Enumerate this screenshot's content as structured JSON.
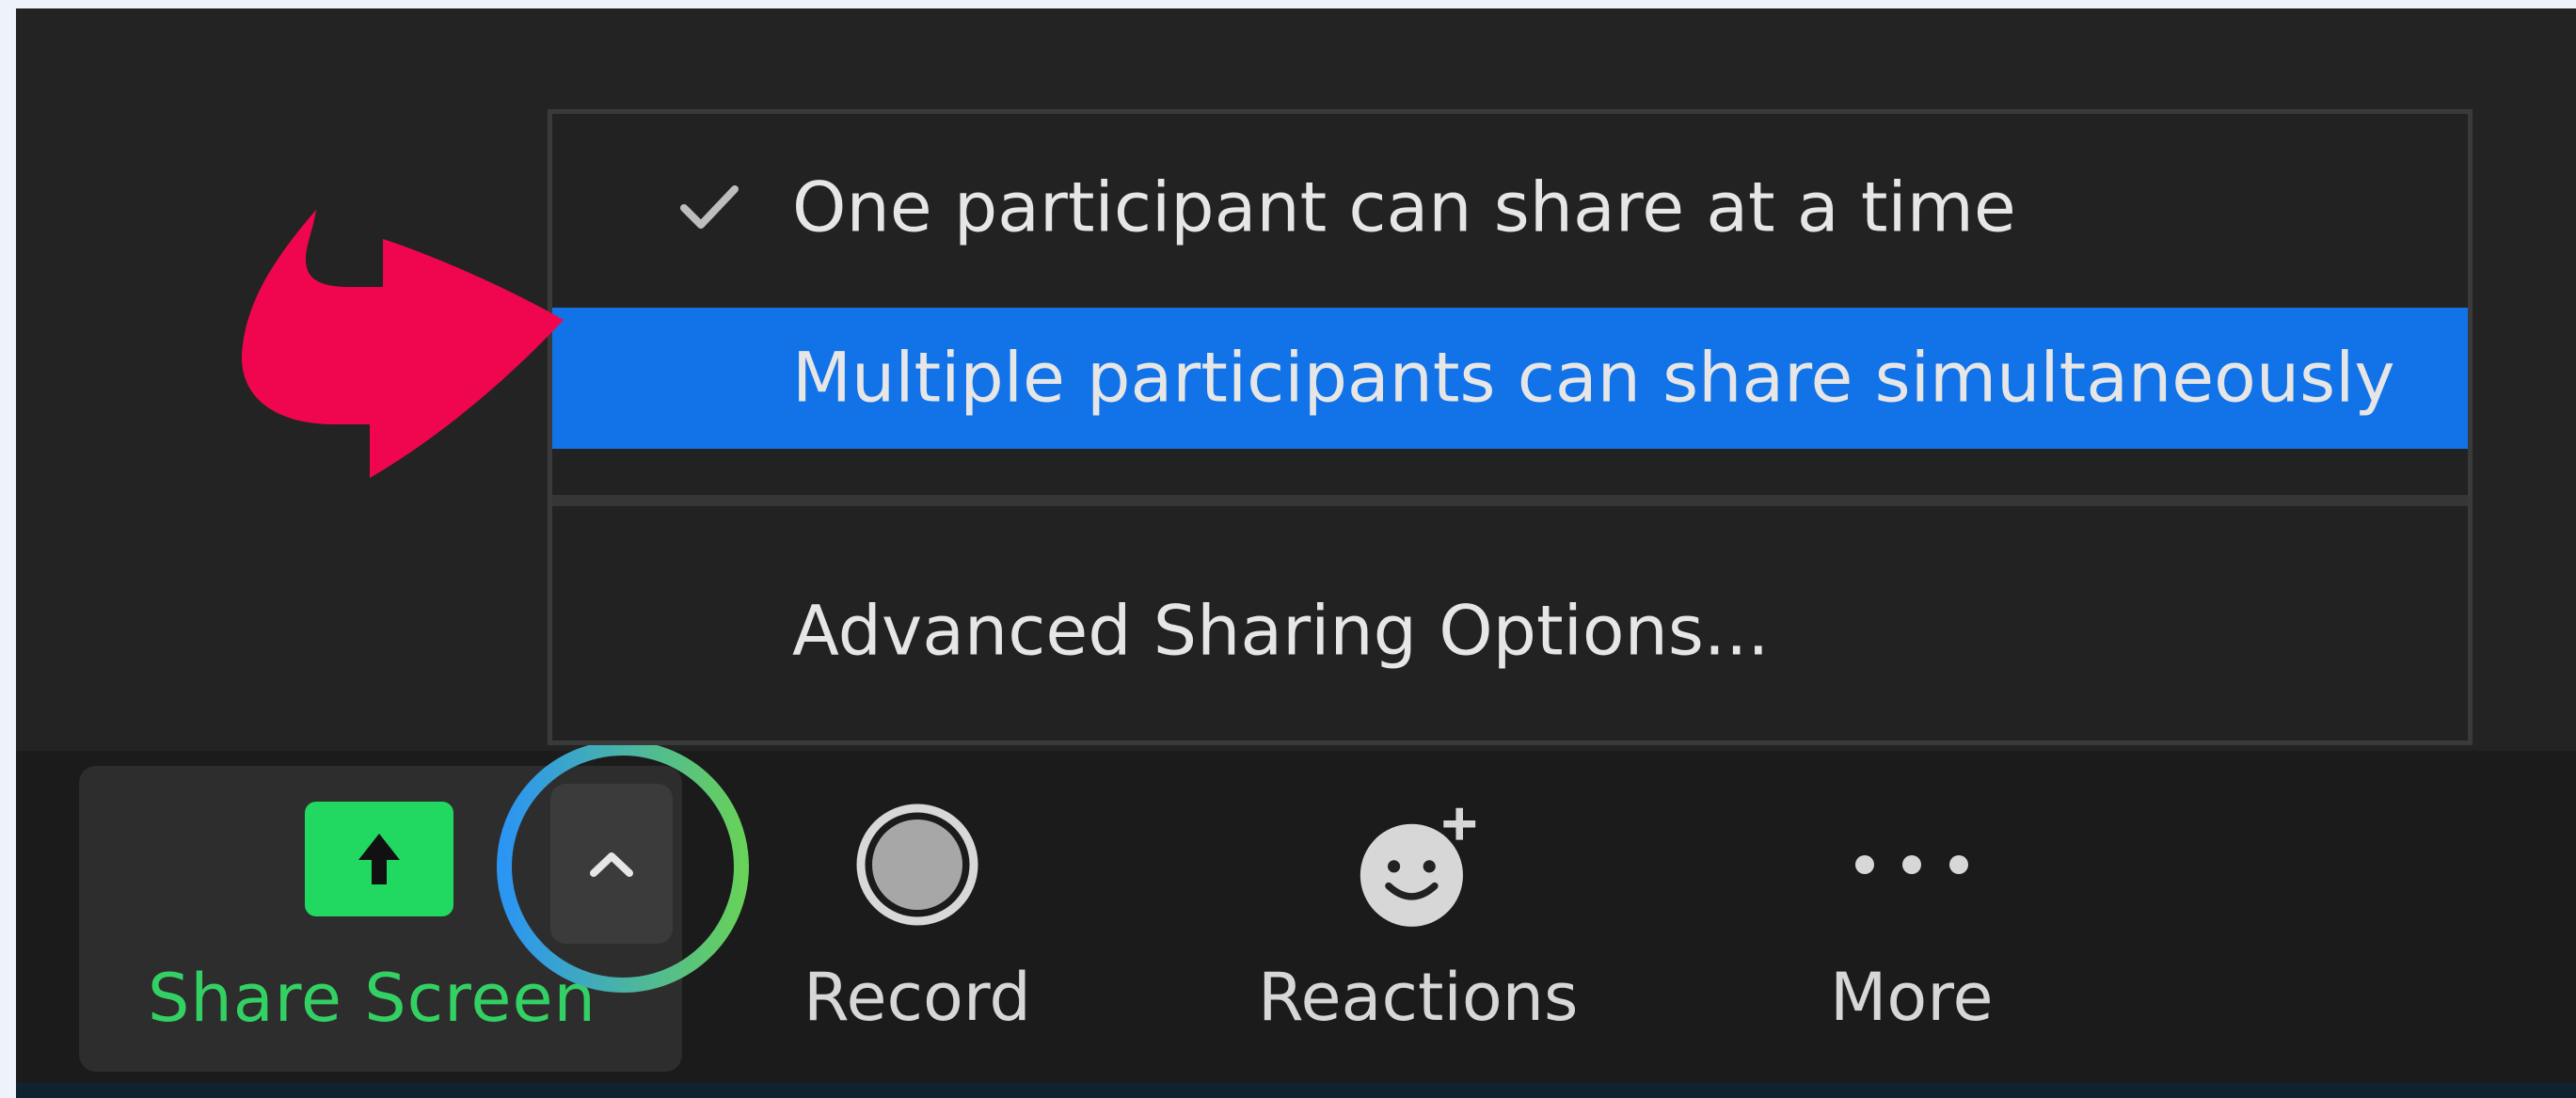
{
  "menu": {
    "items": [
      {
        "label": "One participant can share at a time",
        "checked": true
      },
      {
        "label": "Multiple participants can share simultaneously",
        "highlighted": true
      },
      {
        "label": "Advanced Sharing Options..."
      }
    ]
  },
  "toolbar": {
    "share_screen_label": "Share Screen",
    "record_label": "Record",
    "reactions_label": "Reactions",
    "more_label": "More"
  },
  "icons": {
    "share": "share-screen-arrow-up",
    "caret": "chevron-up",
    "record": "record-circle",
    "reactions": "smiley-with-plus",
    "more": "ellipsis"
  },
  "colors": {
    "menu_highlight": "#1273e8",
    "share_green": "#21d861",
    "share_text": "#33d163",
    "annotation_arrow": "#f0064f",
    "ring_start": "#2b95f4",
    "ring_end": "#67d15a"
  }
}
